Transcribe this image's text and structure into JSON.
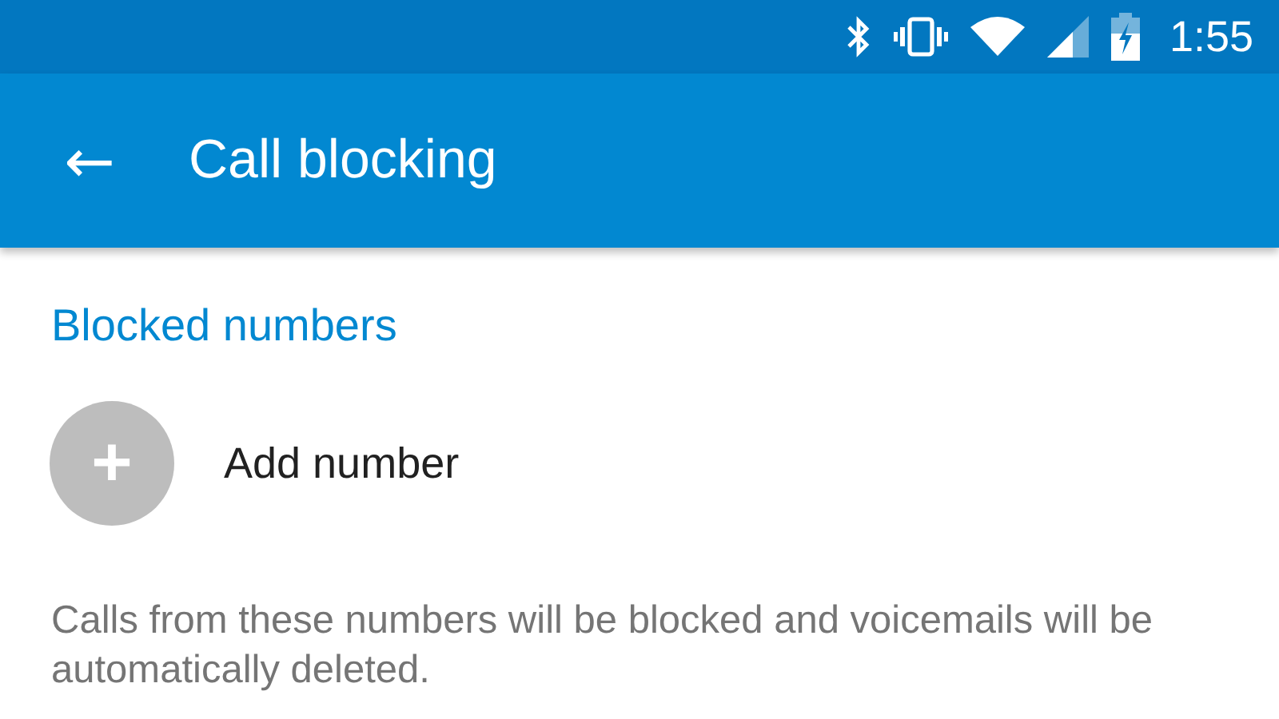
{
  "status_bar": {
    "time": "1:55"
  },
  "toolbar": {
    "back_icon": "←",
    "title": "Call blocking"
  },
  "section": {
    "header": "Blocked numbers"
  },
  "add_row": {
    "icon": "+",
    "label": "Add number"
  },
  "description": "Calls from these numbers will be blocked and voicemails will be automatically deleted."
}
